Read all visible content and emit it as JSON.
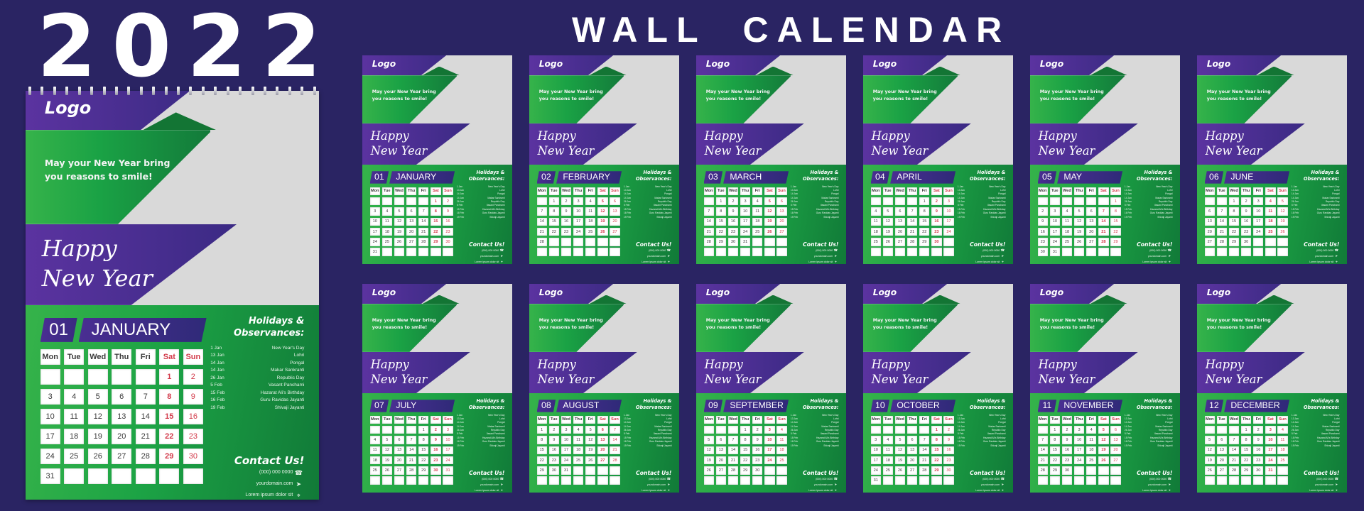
{
  "header": {
    "year": "2022",
    "title": "WALL  CALENDAR"
  },
  "colors": {
    "background": "#2a2463",
    "purple": "#4a2e92",
    "green": "#1ca345",
    "dark_green": "#117a38",
    "photo_placeholder": "#d9d9d9",
    "weekend_red": "#d23a4a"
  },
  "card": {
    "logo": "Logo",
    "tagline_line1": "May your New Year bring",
    "tagline_line2": "you reasons to smile!",
    "greeting_line1": "Happy",
    "greeting_line2": "New Year",
    "holidays_title_line1": "Holidays &",
    "holidays_title_line2": "Observances:",
    "contact_title": "Contact Us!",
    "contacts": [
      {
        "text": "(000) 000 0000",
        "icon": "phone-icon",
        "glyph": "☎"
      },
      {
        "text": "yourdomain.com",
        "icon": "send-icon",
        "glyph": "➤"
      },
      {
        "text": "Lorem ipsum dolor sit",
        "icon": "location-pin-icon",
        "glyph": "⌖"
      }
    ],
    "weekdays": [
      "Mon",
      "Tue",
      "Wed",
      "Thu",
      "Fri",
      "Sat",
      "Sun"
    ]
  },
  "holidays": [
    {
      "date": "1 Jan",
      "name": "New Year's Day"
    },
    {
      "date": "13 Jan",
      "name": "Lohri"
    },
    {
      "date": "14 Jan",
      "name": "Pongal"
    },
    {
      "date": "14 Jan",
      "name": "Makar Sankranti"
    },
    {
      "date": "26 Jan",
      "name": "Republic Day"
    },
    {
      "date": "5 Feb",
      "name": "Vasant Panchami"
    },
    {
      "date": "15 Feb",
      "name": "Hazarat Ali's Birthday"
    },
    {
      "date": "16 Feb",
      "name": "Guru Ravidas Jayanti"
    },
    {
      "date": "19 Feb",
      "name": "Shivaji Jayanti"
    }
  ],
  "months": [
    {
      "num": "01",
      "name": "JANUARY",
      "offset": 5,
      "days": 31
    },
    {
      "num": "02",
      "name": "FEBRUARY",
      "offset": 1,
      "days": 28
    },
    {
      "num": "03",
      "name": "MARCH",
      "offset": 1,
      "days": 31
    },
    {
      "num": "04",
      "name": "APRIL",
      "offset": 4,
      "days": 30
    },
    {
      "num": "05",
      "name": "MAY",
      "offset": 6,
      "days": 31
    },
    {
      "num": "06",
      "name": "JUNE",
      "offset": 2,
      "days": 30
    },
    {
      "num": "07",
      "name": "JULY",
      "offset": 4,
      "days": 31
    },
    {
      "num": "08",
      "name": "AUGUST",
      "offset": 0,
      "days": 31
    },
    {
      "num": "09",
      "name": "SEPTEMBER",
      "offset": 3,
      "days": 30
    },
    {
      "num": "10",
      "name": "OCTOBER",
      "offset": 5,
      "days": 31
    },
    {
      "num": "11",
      "name": "NOVEMBER",
      "offset": 1,
      "days": 30
    },
    {
      "num": "12",
      "name": "DECEMBER",
      "offset": 3,
      "days": 31
    }
  ],
  "featured_month_index": 0
}
